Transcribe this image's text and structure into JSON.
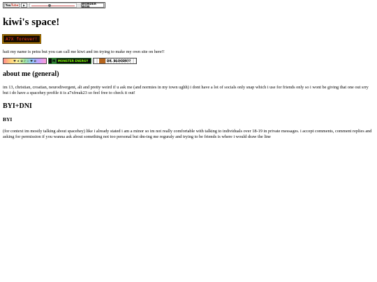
{
  "player": {
    "logo_prefix": "You",
    "logo_accent": "Tube",
    "play_symbol": "▶",
    "song_label": "WONDER WON",
    "progress": 0.4
  },
  "page": {
    "title": "kiwi's space!",
    "banner_text": "A7X forever!",
    "intro": "haii my name is petra but you can call me kiwi and im trying to make my own site on here!!",
    "stamps": [
      {
        "kind": "rainbow",
        "text": "♥ ★ ✿ ♪ ☆ ♥ ✿"
      },
      {
        "kind": "monster",
        "text": "MONSTER ENERGY"
      },
      {
        "kind": "checker",
        "text": "DR. BLOODR??"
      }
    ],
    "sections": {
      "about_heading": "about me (general)",
      "about_text": "im 13, christian, croatian, neurodivergent, alt and pretty weird if u ask me (and normies in my town ughh) i dont have a lot of socials only snap which i use for friends only so i wont be giving that one out srry but i do have a spacehey profile it is a7xfreak23 so feel free to check it out!",
      "byi_dni_heading": "BYI+DNI",
      "byi_heading": "BYI",
      "byi_text": "(for context im mostly talking about spacehey) like i already stated i am a minor so im not really comfortable with talking to individuals over 18-19 in private messages. i accept comments, comment replies and asking for permission if you wanna ask about something not too personal but dm-ing me reguraly and trying to be friends is where i would draw the line"
    }
  }
}
